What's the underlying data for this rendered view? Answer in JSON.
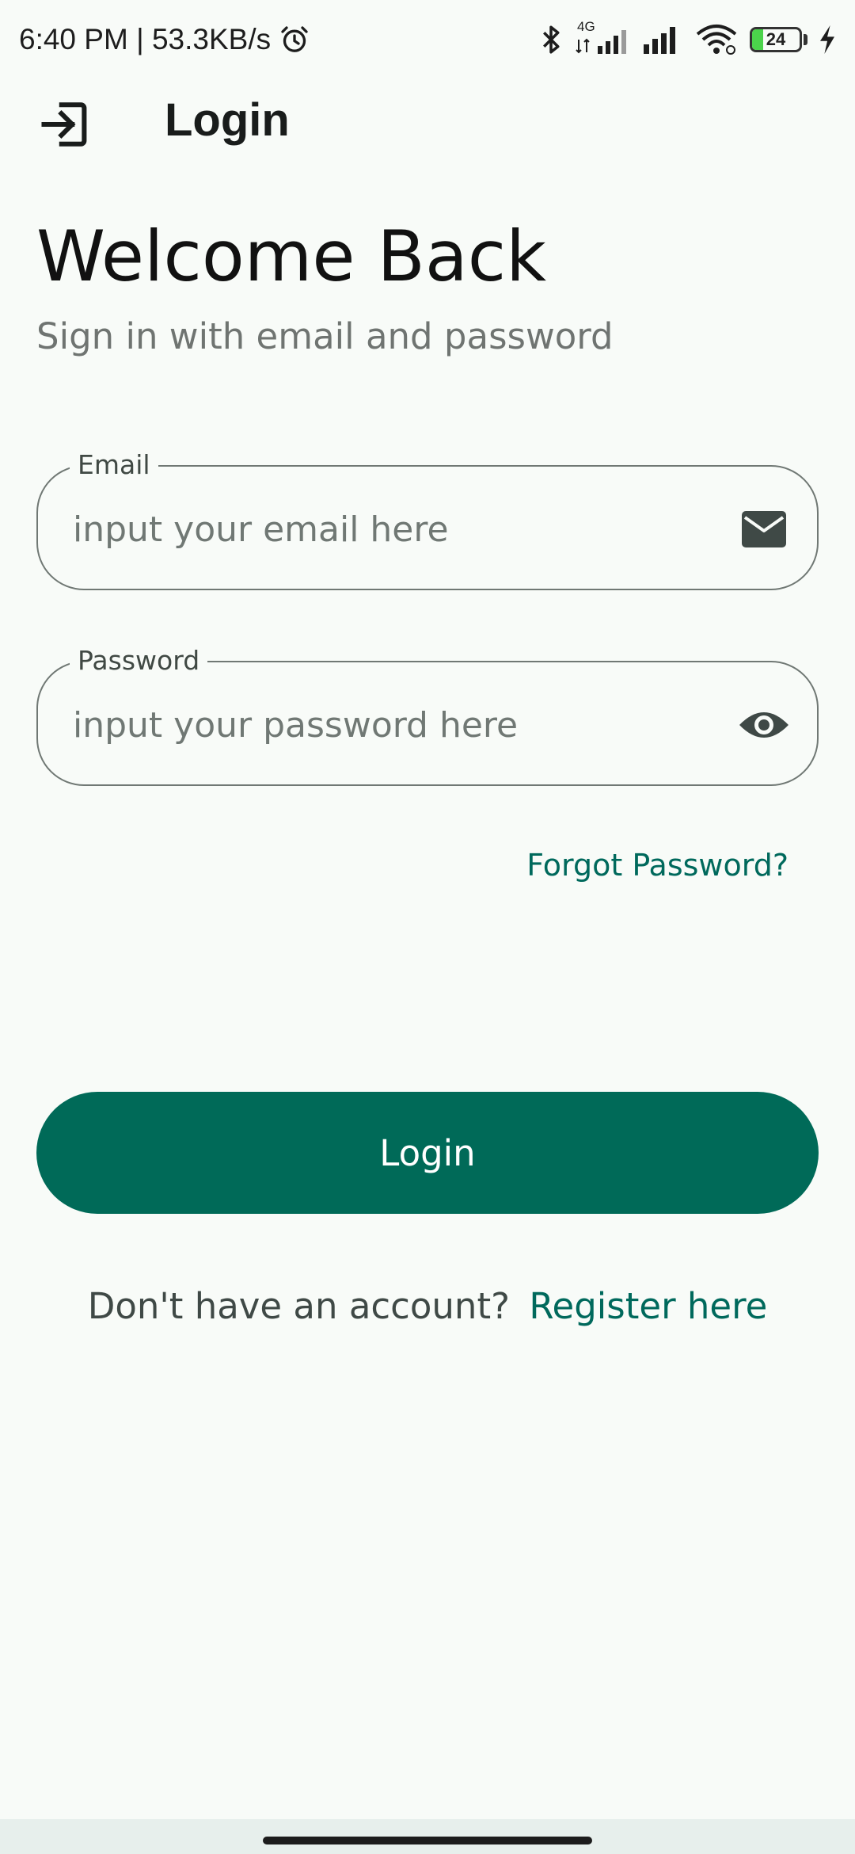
{
  "status_bar": {
    "time_speed": "6:40 PM | 53.3KB/s",
    "network_type": "4G",
    "battery_level": "24",
    "battery_fraction": 0.24,
    "icons": [
      "alarm-icon",
      "bluetooth-icon",
      "signal-4g-icon",
      "signal-icon",
      "wifi-icon",
      "battery-icon",
      "charging-icon"
    ]
  },
  "app_bar": {
    "icon": "login-icon",
    "title": "Login"
  },
  "header": {
    "title": "Welcome Back",
    "subtitle": "Sign in with email and password"
  },
  "form": {
    "email": {
      "label": "Email",
      "placeholder": "input your email here",
      "value": "",
      "trailing_icon": "mail-icon"
    },
    "password": {
      "label": "Password",
      "placeholder": "input your password here",
      "value": "",
      "trailing_icon": "eye-icon"
    },
    "forgot_password": "Forgot Password?",
    "submit_label": "Login"
  },
  "footer": {
    "prompt": "Don't have an account?",
    "register_link": "Register here"
  },
  "colors": {
    "primary": "#006a58",
    "link": "#00695c",
    "background": "#f8fbf8",
    "outline": "#707874"
  }
}
